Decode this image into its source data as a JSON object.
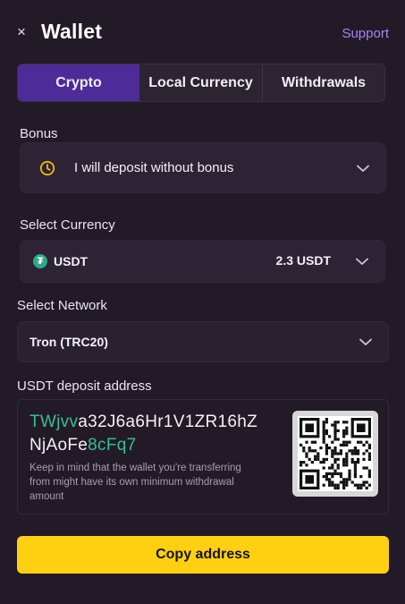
{
  "header": {
    "close_icon": "×",
    "title": "Wallet",
    "support_label": "Support"
  },
  "tabs": [
    {
      "label": "Crypto",
      "active": true
    },
    {
      "label": "Local Currency",
      "active": false
    },
    {
      "label": "Withdrawals",
      "active": false
    }
  ],
  "bonus": {
    "label": "Bonus",
    "value": "I will deposit without bonus",
    "icon": "clock-icon"
  },
  "currency": {
    "label": "Select Currency",
    "value": "USDT",
    "balance": "2.3 USDT",
    "icon": "usdt-icon",
    "icon_glyph": "₮"
  },
  "network": {
    "label": "Select Network",
    "value": "Tron (TRC20)"
  },
  "deposit": {
    "label": "USDT deposit address",
    "address_part1_green": "TWjvv",
    "address_part1_white": "a32J6a6Hr1V1ZR16hZ",
    "address_part2_white": "NjAoFe",
    "address_part2_green": "8cFq7",
    "note": "Keep in mind that the wallet you're transferring from might have its own minimum withdrawal amount"
  },
  "copy_button_label": "Copy address",
  "colors": {
    "accent": "#4d2c9a",
    "support": "#a883f2",
    "highlight": "#34c08f",
    "button": "#ffd012",
    "background": "#221a27"
  }
}
